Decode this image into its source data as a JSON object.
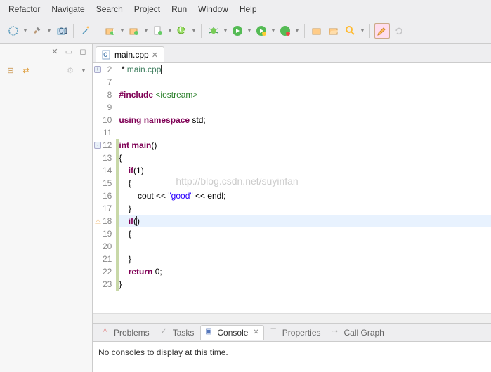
{
  "menu": {
    "items": [
      "Refactor",
      "Navigate",
      "Search",
      "Project",
      "Run",
      "Window",
      "Help"
    ]
  },
  "tabs": {
    "file": "main.cpp"
  },
  "code": {
    "lines": [
      {
        "n": 2,
        "html": " * <span class='cmt'>main.cpp</span><span class='cursor'></span>",
        "fold": "+"
      },
      {
        "n": 7,
        "html": ""
      },
      {
        "n": 8,
        "html": "<span class='kw'>#include</span> <span class='inc'>&lt;iostream&gt;</span>"
      },
      {
        "n": 9,
        "html": ""
      },
      {
        "n": 10,
        "html": "<span class='kw'>using</span> <span class='kw'>namespace</span> std;"
      },
      {
        "n": 11,
        "html": ""
      },
      {
        "n": 12,
        "html": "<span class='kw'>int</span> <span class='kw'>main</span>()",
        "fold": "-",
        "change": true
      },
      {
        "n": 13,
        "html": "{",
        "change": true
      },
      {
        "n": 14,
        "html": "    <span class='kw'>if</span>(1)",
        "change": true
      },
      {
        "n": 15,
        "html": "    {",
        "change": true
      },
      {
        "n": 16,
        "html": "        cout &lt;&lt; <span class='str'>\"good\"</span> &lt;&lt; endl;",
        "change": true
      },
      {
        "n": 17,
        "html": "    }",
        "change": true
      },
      {
        "n": 18,
        "html": "    <span class='kw'>if</span>(<span class='cursor'></span>)",
        "change": true,
        "hl": true,
        "warn": true
      },
      {
        "n": 19,
        "html": "    {",
        "change": true
      },
      {
        "n": 20,
        "html": "",
        "change": true
      },
      {
        "n": 21,
        "html": "    }",
        "change": true
      },
      {
        "n": 22,
        "html": "    <span class='kw'>return</span> 0;",
        "change": true
      },
      {
        "n": 23,
        "html": "}",
        "change": true
      }
    ]
  },
  "watermark": "http://blog.csdn.net/suyinfan",
  "bottom": {
    "tabs": [
      "Problems",
      "Tasks",
      "Console",
      "Properties",
      "Call Graph"
    ],
    "active": 2,
    "content": "No consoles to display at this time."
  }
}
